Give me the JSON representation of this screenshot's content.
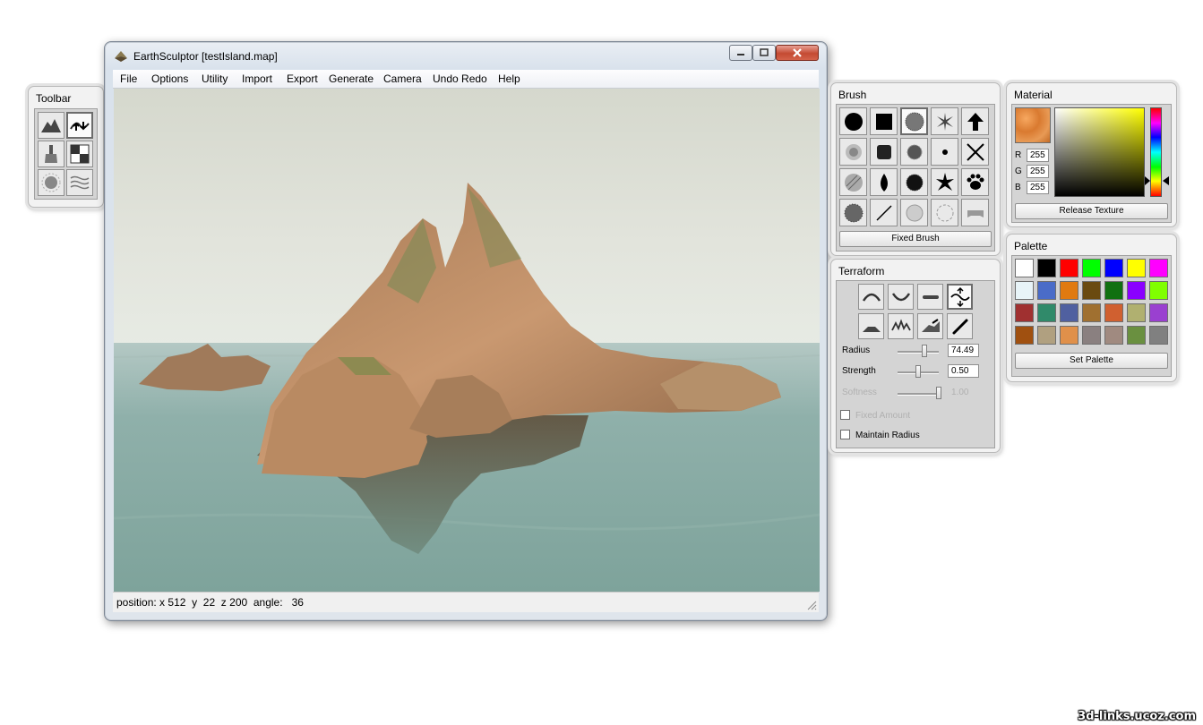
{
  "toolbar_panel": {
    "title": "Toolbar"
  },
  "window": {
    "title": "EarthSculptor [testIsland.map]",
    "menu": [
      "File",
      "Options",
      "Utility",
      "Import",
      "Export",
      "Generate",
      "Camera",
      "Undo Redo",
      "Help"
    ],
    "status": {
      "position_label": "position:",
      "x_label": "x",
      "x": "512",
      "y_label": "y",
      "y": "22",
      "z_label": "z",
      "z": "200",
      "angle_label": "angle:",
      "angle": "36"
    }
  },
  "brush_panel": {
    "title": "Brush",
    "fixed_brush_label": "Fixed Brush",
    "brush_icons": [
      "circle-brush-icon",
      "square-brush-icon",
      "noise-circle-brush-icon",
      "star-burst-brush-icon",
      "arrow-up-brush-icon",
      "soft-dots-brush-icon",
      "soft-square-brush-icon",
      "splat-brush-icon",
      "dot-brush-icon",
      "x-brush-icon",
      "stripes-brush-icon",
      "drop-brush-icon",
      "fuzzy-brush-icon",
      "starburst-brush-icon",
      "paw-brush-icon",
      "grain-brush-icon",
      "line-brush-icon",
      "cloud-brush-icon",
      "swirl-brush-icon",
      "gamepad-brush-icon"
    ]
  },
  "terraform_panel": {
    "title": "Terraform",
    "tools": [
      "raise-icon",
      "lower-icon",
      "flatten-icon",
      "smooth-icon",
      "plateau-icon",
      "noise-icon",
      "erode-icon",
      "paint-icon"
    ],
    "radius_label": "Radius",
    "radius_value": "74.49",
    "radius_level": 0.66,
    "strength_label": "Strength",
    "strength_value": "0.50",
    "strength_level": 0.5,
    "softness_label": "Softness",
    "softness_value": "1.00",
    "softness_level": 1.0,
    "fixed_amount_label": "Fixed Amount",
    "maintain_radius_label": "Maintain Radius"
  },
  "material_panel": {
    "title": "Material",
    "r_label": "R",
    "r_value": "255",
    "g_label": "G",
    "g_value": "255",
    "b_label": "B",
    "b_value": "255",
    "release_label": "Release Texture"
  },
  "palette_panel": {
    "title": "Palette",
    "set_label": "Set Palette",
    "colors": [
      "#ffffff",
      "#000000",
      "#ff0000",
      "#00ff00",
      "#0000ff",
      "#ffff00",
      "#ff00ff",
      "#e8f4f8",
      "#4a6cc8",
      "#e07a10",
      "#6a4a10",
      "#107010",
      "#8a00ff",
      "#80ff00",
      "#a03030",
      "#308a6a",
      "#5060a0",
      "#a07030",
      "#d06030",
      "#b0b070",
      "#9a40d0",
      "#a05010",
      "#b0a080",
      "#e0904a",
      "#8a8080",
      "#a08a80",
      "#6a9040",
      "#808080"
    ]
  },
  "watermark": "3d-links.ucoz.com"
}
